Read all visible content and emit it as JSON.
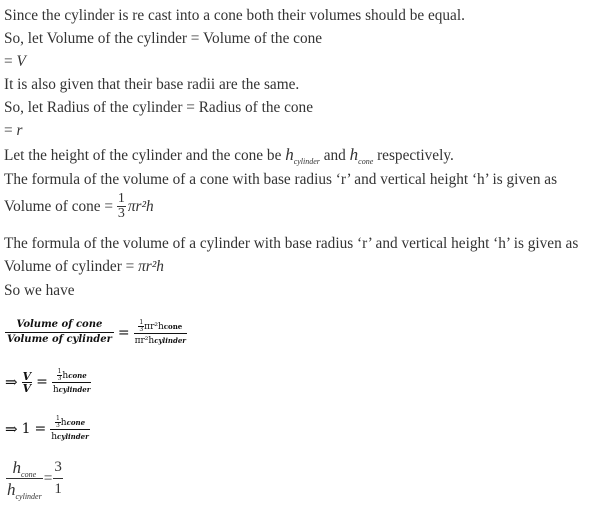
{
  "lines": {
    "l1": "Since the cylinder is re cast into a cone both their volumes should be equal.",
    "l2": "So, let Volume of the cylinder = Volume of the cone",
    "l3_eq": "= ",
    "l3_var": "V",
    "l4": "It is also given that their base radii are the same.",
    "l5": "So, let Radius of the cylinder = Radius of the cone",
    "l6_eq": "= ",
    "l6_var": "r",
    "l7_a": "Let the height of the cylinder and the cone be ",
    "l7_h1": "h",
    "l7_h1_sub": "cylinder",
    "l7_b": " and ",
    "l7_h2": "h",
    "l7_h2_sub": "cone",
    "l7_c": " respectively.",
    "l8": "The formula of the volume of a cone with base radius ‘r’ and vertical height ‘h’ is given as",
    "l9_label": "Volume of cone = ",
    "l9_num": "1",
    "l9_den": "3",
    "l9_rest": "πr²h",
    "l10": "The formula of the volume of a cylinder with base radius ‘r’ and vertical height ‘h’ is given as",
    "l11_label": "Volume of cylinder = ",
    "l11_rest": "πr²h",
    "l12": "So we have"
  },
  "equations": {
    "e1": {
      "lhs_num": "Volume of cone",
      "lhs_den": "Volume of cylinder",
      "eq": "=",
      "rhs_inner_num": "1",
      "rhs_inner_den": "3",
      "rhs_num_rest": "πr²h",
      "rhs_num_sub": "cone",
      "rhs_den": "πr²h",
      "rhs_den_sub": "cylinder"
    },
    "e2": {
      "arrow": "⇒",
      "lhs_num": "V",
      "lhs_den": "V",
      "eq": "=",
      "rhs_inner_num": "1",
      "rhs_inner_den": "3",
      "rhs_num_rest": "h",
      "rhs_num_sub": "cone",
      "rhs_den": "h",
      "rhs_den_sub": "cylinder"
    },
    "e3": {
      "arrow": "⇒",
      "lhs": "1",
      "eq": "=",
      "rhs_inner_num": "1",
      "rhs_inner_den": "3",
      "rhs_num_rest": "h",
      "rhs_num_sub": "cone",
      "rhs_den": "h",
      "rhs_den_sub": "cylinder"
    },
    "e4": {
      "lhs_num": "h",
      "lhs_num_sub": "cone",
      "lhs_den": "h",
      "lhs_den_sub": "cylinder",
      "eq": "=",
      "rhs_num": "3",
      "rhs_den": "1"
    }
  }
}
